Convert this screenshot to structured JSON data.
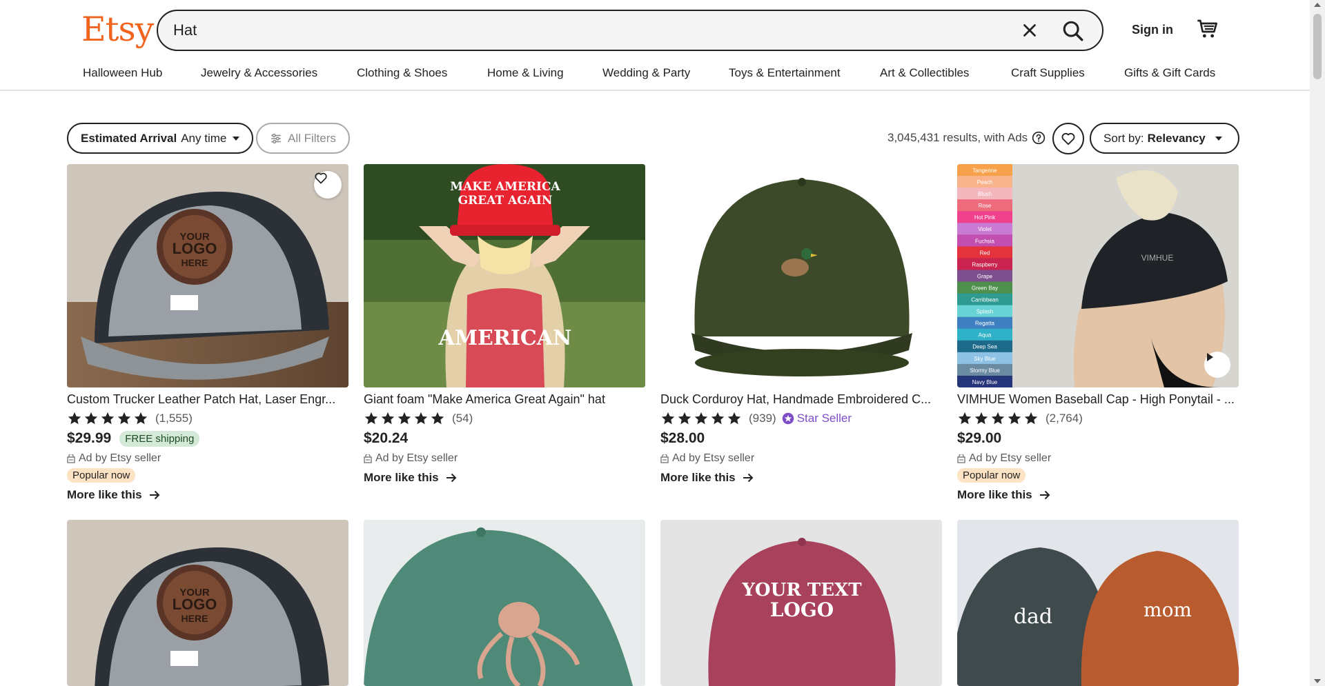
{
  "header": {
    "logo": "Etsy",
    "search_value": "Hat",
    "sign_in": "Sign in",
    "categories": [
      "Halloween Hub",
      "Jewelry & Accessories",
      "Clothing & Shoes",
      "Home & Living",
      "Wedding & Party",
      "Toys & Entertainment",
      "Art & Collectibles",
      "Craft Supplies",
      "Gifts & Gift Cards"
    ]
  },
  "filters": {
    "arrival_label": "Estimated Arrival",
    "arrival_value": "Any time",
    "all_filters": "All Filters",
    "results": "3,045,431 results, with Ads",
    "sort_label": "Sort by:",
    "sort_value": "Relevancy"
  },
  "colors": {
    "accent": "#f1641e",
    "star_seller": "#7e4ec7",
    "free_shipping_bg": "#d4e9d7",
    "popular_bg": "#fde3c4"
  },
  "products": [
    {
      "title": "Custom Trucker Leather Patch Hat, Laser Engr...",
      "rating": 5,
      "reviews": "(1,555)",
      "price": "$29.99",
      "free_shipping": "FREE shipping",
      "ad": "Ad by Etsy seller",
      "badge": "Popular now",
      "more": "More like this",
      "image_text": [
        "YOUR",
        "LOGO",
        "HERE"
      ]
    },
    {
      "title": "Giant foam \"Make America Great Again\" hat",
      "rating": 5,
      "reviews": "(54)",
      "price": "$20.24",
      "ad": "Ad by Etsy seller",
      "more": "More like this",
      "image_text": [
        "MAKE AMERICA",
        "GREAT AGAIN",
        "AMERICAN"
      ]
    },
    {
      "title": "Duck Corduroy Hat, Handmade Embroidered C...",
      "rating": 5,
      "reviews": "(939)",
      "star_seller": "Star Seller",
      "price": "$28.00",
      "ad": "Ad by Etsy seller",
      "more": "More like this"
    },
    {
      "title": "VIMHUE Women Baseball Cap - High Ponytail - ...",
      "rating": 5,
      "reviews": "(2,764)",
      "price": "$29.00",
      "ad": "Ad by Etsy seller",
      "badge": "Popular now",
      "more": "More like this",
      "image_text": [
        "VIMHUE"
      ],
      "swatches": [
        "Tangerine",
        "Peach",
        "Blush",
        "Rose",
        "Hot Pink",
        "Violet",
        "Fuchsia",
        "Red",
        "Raspberry",
        "Grape",
        "Green Bay",
        "Carribbean",
        "Splash",
        "Regatta",
        "Aqua",
        "Deep Sea",
        "Sky Blue",
        "Stormy Blue",
        "Navy Blue"
      ]
    }
  ],
  "row2_image_text": [
    [
      "YOUR",
      "LOGO",
      "HERE"
    ],
    [],
    [
      "YOUR TEXT",
      "LOGO"
    ],
    [
      "dad",
      "mom"
    ]
  ]
}
